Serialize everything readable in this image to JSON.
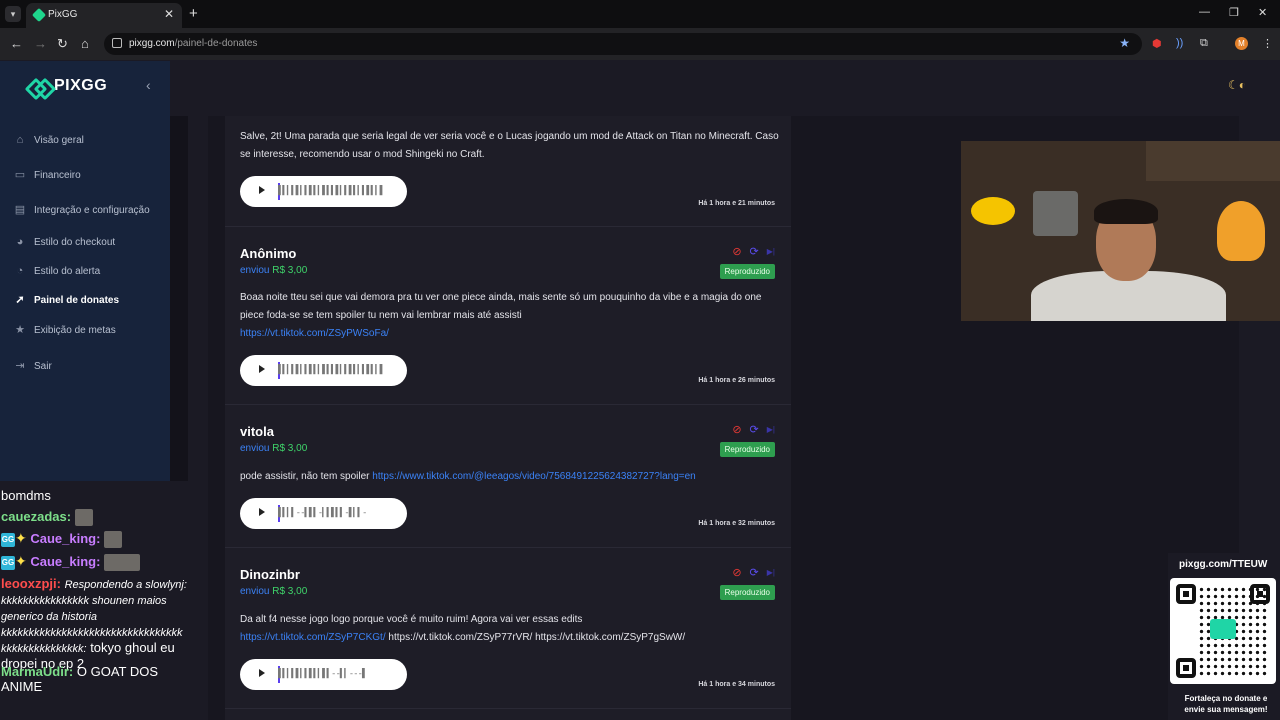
{
  "browser": {
    "tab_title": "PixGG",
    "url_host": "pixgg.com",
    "url_path": "/painel-de-donates",
    "profile_initial": "M"
  },
  "sidebar": {
    "logo": "PIXGG",
    "items": [
      {
        "label": "Visão geral",
        "icon": "home-icon"
      },
      {
        "label": "Financeiro",
        "icon": "wallet-icon"
      },
      {
        "label": "Integração e configuração",
        "icon": "settings-icon"
      },
      {
        "label": "Estilo do checkout",
        "icon": "palette-icon"
      },
      {
        "label": "Estilo do alerta",
        "icon": "palette-icon"
      },
      {
        "label": "Painel de donates",
        "icon": "rocket-icon"
      },
      {
        "label": "Exibição de metas",
        "icon": "star-icon"
      },
      {
        "label": "Sair",
        "icon": "logout-icon"
      }
    ],
    "active_index": 5
  },
  "donations": [
    {
      "name": "",
      "sent_label": "",
      "amount": "",
      "message": "Salve, 2t! Uma parada que seria legal de ver seria você e o Lucas jogando um mod de Attack on Titan no Minecraft. Caso se interesse, recomendo usar o mod Shingeki no Craft.",
      "link": "",
      "link_extra": "",
      "time": "Há 1 hora e 21 minutos",
      "status": "",
      "wave": "▌▍▎▍▌▎▍▌▍▎▌▍▍▌▎▍▌▍▎▍▌▍▎▌"
    },
    {
      "name": "Anônimo",
      "sent_label": "enviou",
      "amount": "R$ 3,00",
      "message": "Boaa noite tteu sei que vai demora pra tu ver one piece ainda, mais sente só um pouquinho da vibe e a magia do one piece foda-se se tem spoiler tu nem vai lembrar mais até assisti",
      "link": "https://vt.tiktok.com/ZSyPWSoFa/",
      "link_extra": "",
      "time": "Há 1 hora e 26 minutos",
      "status": "Reproduzido",
      "wave": "▌▍▎▍▌▎▍▌▍▎▌▍▍▌▎▍▌▍▎▍▌▍▎▌"
    },
    {
      "name": "vitola",
      "sent_label": "enviou",
      "amount": "R$ 3,00",
      "message": "pode assistir, não tem spoiler",
      "link": "https://www.tiktok.com/@leeagos/video/7568491225624382727?lang=en",
      "link_extra": "",
      "time": "Há 1 hora e 32 minutos",
      "status": "Reproduzido",
      "wave": "▌▍▎▍--▍▌▍-▎▍▌▍▍-▌▎▍-"
    },
    {
      "name": "Dinozinbr",
      "sent_label": "enviou",
      "amount": "R$ 3,00",
      "message": "Da alt f4 nesse jogo logo porque você é muito ruim! Agora vai ver essas edits",
      "link": "https://vt.tiktok.com/ZSyP7CKGt/",
      "link_extra": " https://vt.tiktok.com/ZSyP77rVR/ https://vt.tiktok.com/ZSyP7gSwW/",
      "time": "Há 1 hora e 34 minutos",
      "status": "Reproduzido",
      "wave": "▌▍▎▍▌▎▍▌▍▎▌▍--▍▎---▌"
    }
  ],
  "chat": [
    {
      "user": "",
      "text": "bomdms",
      "color": "#ffffff"
    },
    {
      "user": "cauezadas:",
      "text": "",
      "color": "#7ddf8a"
    },
    {
      "user": "Caue_king:",
      "text": "",
      "color": "#c87dff"
    },
    {
      "user": "Caue_king:",
      "text": "",
      "color": "#c87dff"
    },
    {
      "user": "leooxzpji:",
      "text": "Respondendo a slowlynj: kkkkkkkkkkkkkkkk shounen maios generico da historia kkkkkkkkkkkkkkkkkkkkkkkkkkkkkkkkk kkkkkkkkkkkkkkk:",
      "text2": "tokyo ghoul eu dropei no ep 2",
      "color": "#ff4d4d"
    },
    {
      "user": "MarmaUdir:",
      "text": "O GOAT DOS ANIME",
      "color": "#7ddf8a"
    }
  ],
  "qr": {
    "url": "pixgg.com/TTEUW",
    "caption": "Fortaleça no donate e envie sua mensagem!"
  },
  "colors": {
    "sidebar_bg": "#17233b",
    "brand": "#1fd5a6",
    "amount": "#3fd46a",
    "link": "#3b82f6",
    "status_badge": "#2e9e4f",
    "ban": "#e53935",
    "replay": "#5b4df0"
  }
}
